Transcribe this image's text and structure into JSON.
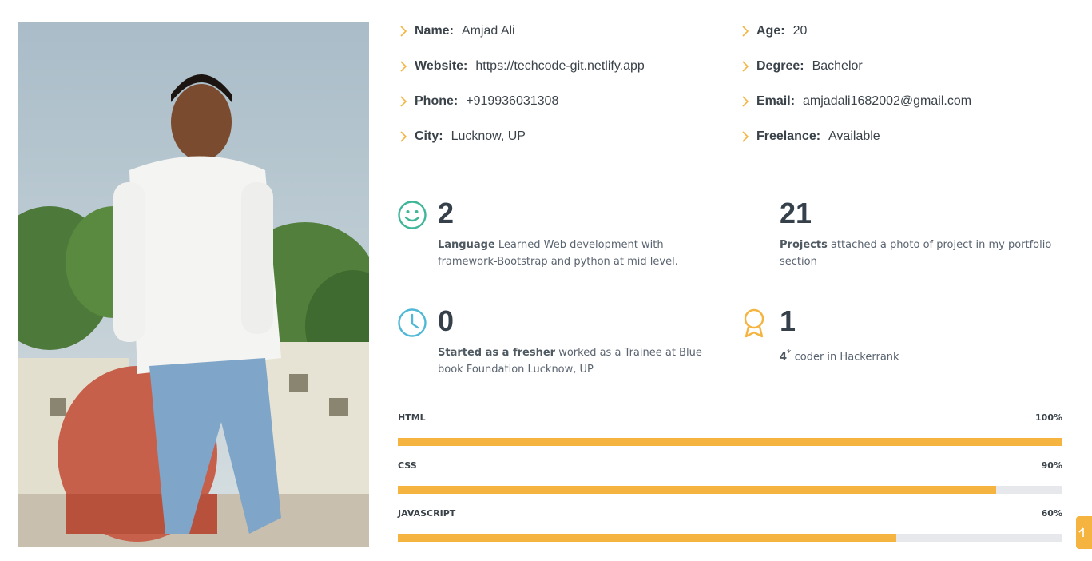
{
  "colors": {
    "accent": "#f4b43f",
    "chevron": "#f4b43f",
    "smile_icon": "#3fb59a",
    "clock_icon": "#4fb8d6",
    "award_icon": "#f4b43f",
    "track": "#e6e8ec"
  },
  "profile_photo": {
    "icon": "portrait-photo"
  },
  "info_left": [
    {
      "label": "Name:",
      "value": "Amjad Ali"
    },
    {
      "label": "Website:",
      "value": "https://techcode-git.netlify.app"
    },
    {
      "label": "Phone:",
      "value": "+919936031308"
    },
    {
      "label": "City:",
      "value": "Lucknow, UP"
    }
  ],
  "info_right": [
    {
      "label": "Age:",
      "value": "20"
    },
    {
      "label": "Degree:",
      "value": "Bachelor"
    },
    {
      "label": "Email:",
      "value": "amjadali1682002@gmail.com"
    },
    {
      "label": "Freelance:",
      "value": "Available"
    }
  ],
  "counters": [
    {
      "number": "2",
      "title": "Language",
      "text": " Learned Web development with framework-Bootstrap and python at mid level.",
      "icon": "smile-icon"
    },
    {
      "number": "21",
      "title": "Projects",
      "text": " attached a photo of project in my portfolio section",
      "icon": ""
    },
    {
      "number": "0",
      "title": "Started as a fresher",
      "text": " worked as a Trainee at Blue book Foundation Lucknow, UP",
      "icon": "clock-icon"
    },
    {
      "number": "1",
      "title": "4",
      "sup": "*",
      "text": " coder in Hackerrank",
      "icon": "award-icon"
    }
  ],
  "skills": [
    {
      "name": "HTML",
      "percent_label": "100%",
      "fill": 1.0
    },
    {
      "name": "CSS",
      "percent_label": "90%",
      "fill": 0.9
    },
    {
      "name": "JAVASCRIPT",
      "percent_label": "60%",
      "fill": 0.75
    }
  ],
  "back_to_top": {
    "icon": "arrow-up-icon"
  }
}
